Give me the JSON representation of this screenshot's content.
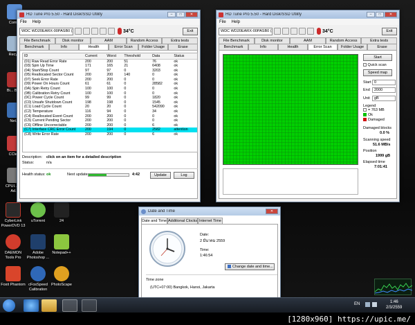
{
  "desktop_icons": [
    {
      "label": "Com..."
    },
    {
      "label": "Recy..."
    },
    {
      "label": "Bi... Be..."
    },
    {
      "label": "Net..."
    },
    {
      "label": "CCle..."
    },
    {
      "label": "CPUI... EF Ad..."
    },
    {
      "label": "CyberLink PowerDVD 13"
    },
    {
      "label": "uTorrent"
    },
    {
      "label": "24"
    },
    {
      "label": "DAEMON Tools Pro"
    },
    {
      "label": "Adobe Photoshop ..."
    },
    {
      "label": "Notepad++"
    },
    {
      "label": "Foxit Phantom"
    },
    {
      "label": "cFosSpeed Calibration"
    },
    {
      "label": "PhotoScape"
    }
  ],
  "left_window": {
    "title": "HD Tune Pro 5.50 - Hard Disk/SSD Utility",
    "menu": [
      "File",
      "Help"
    ],
    "drive": "WDC WD20EARX-00PASB0 (2000 gB)",
    "temperature": "34°C",
    "exit_label": "Exit",
    "tabs_top": [
      "File Benchmark",
      "Disk monitor",
      "AAM",
      "Random Access",
      "Extra tests"
    ],
    "tabs_bottom": [
      "Benchmark",
      "Info",
      "Health",
      "Error Scan",
      "Folder Usage",
      "Erase"
    ],
    "columns": [
      "ID",
      "Current",
      "Worst",
      "Threshold",
      "Data",
      "Status"
    ],
    "rows": [
      [
        "(01) Raw Read Error Rate",
        "200",
        "200",
        "51",
        "76",
        "ok"
      ],
      [
        "(03) Spin Up Time",
        "171",
        "165",
        "21",
        "6408",
        "ok"
      ],
      [
        "(04) Start/Stop Count",
        "97",
        "97",
        "0",
        "3203",
        "ok"
      ],
      [
        "(05) Reallocated Sector Count",
        "200",
        "200",
        "140",
        "0",
        "ok"
      ],
      [
        "(07) Seek Error Rate",
        "200",
        "200",
        "0",
        "0",
        "ok"
      ],
      [
        "(09) Power On Hours Count",
        "61",
        "61",
        "0",
        "28582",
        "ok"
      ],
      [
        "(0A) Spin Retry Count",
        "100",
        "100",
        "0",
        "0",
        "ok"
      ],
      [
        "(0B) Calibration Retry Count",
        "100",
        "100",
        "0",
        "0",
        "ok"
      ],
      [
        "(0C) Power Cycle Count",
        "99",
        "99",
        "0",
        "1820",
        "ok"
      ],
      [
        "(C0) Unsafe Shutdown Count",
        "198",
        "198",
        "0",
        "1545",
        "ok"
      ],
      [
        "(C1) Load Cycle Count",
        "20",
        "20",
        "0",
        "542090",
        "ok"
      ],
      [
        "(C2) Temperature",
        "116",
        "94",
        "0",
        "34",
        "ok"
      ],
      [
        "(C4) Reallocated Event Count",
        "200",
        "200",
        "0",
        "0",
        "ok"
      ],
      [
        "(C5) Current Pending Sector",
        "200",
        "200",
        "0",
        "0",
        "ok"
      ],
      [
        "(C6) Offline Uncorrectable",
        "200",
        "200",
        "0",
        "6",
        "ok"
      ],
      [
        "(C7) Interface CRC Error Count",
        "200",
        "194",
        "0",
        "2582",
        "attention"
      ],
      [
        "(C8) Write Error Rate",
        "200",
        "200",
        "0",
        "6",
        "ok"
      ]
    ],
    "description_label": "Description:",
    "description_value": "click on an item for a detailed description",
    "status_label": "Status:",
    "status_value": "n/a",
    "health_label": "Health status:",
    "health_value": "ok",
    "next_update_label": "Next update:",
    "next_update_time": "4:42",
    "next_update_progress": 0.45,
    "update_label": "Update",
    "log_label": "Log"
  },
  "right_window": {
    "title": "HD Tune Pro 5.50 - Hard Disk/SSD Utility",
    "menu": [
      "File",
      "Help"
    ],
    "drive": "WDC WD20EARX-00PASB0 (2000 gB)",
    "temperature": "34°C",
    "exit_label": "Exit",
    "tabs_top": [
      "File Benchmark",
      "Disk monitor",
      "AAM",
      "Random Access",
      "Extra tests"
    ],
    "tabs_bottom": [
      "Benchmark",
      "Info",
      "Health",
      "Error Scan",
      "Folder Usage",
      "Erase"
    ],
    "start_label": "Start",
    "quick_scan_label": "Quick scan",
    "speed_map_label": "Speed map",
    "start_field_label": "Start",
    "start_value": "0",
    "end_field_label": "End",
    "end_value": "2000",
    "unit_label": "Unit",
    "unit_value": "gB",
    "legend_label": "Legend",
    "legend_items": [
      "= 763 MB",
      "Ok",
      "Damaged"
    ],
    "legend_colors": [
      "#ffffff",
      "#00c000",
      "#d01010"
    ],
    "damaged_blocks_label": "Damaged blocks",
    "damaged_blocks_value": "0.0 %",
    "scanning_speed_label": "Scanning speed",
    "scanning_speed_value": "51.6 MB/s",
    "position_label": "Position",
    "position_value": "1999 gB",
    "elapsed_label": "Elapsed time",
    "elapsed_value": "7:01:41"
  },
  "datetime_dialog": {
    "title": "Date and Time",
    "tabs": [
      "Date and Time",
      "Additional Clocks",
      "Internet Time"
    ],
    "date_label": "Date:",
    "date_value": "2 มีนาคม 2559",
    "time_label": "Time:",
    "time_value": "1:46:54",
    "change_label": "Change date and time...",
    "timezone_label": "Time zone",
    "timezone_value": "(UTC+07:00) Bangkok, Hanoi, Jakarta"
  },
  "taskbar": {
    "language": "EN",
    "clock_time": "1:46",
    "clock_date": "2/3/2559"
  },
  "watermark": "[1280x960] https://upic.me/"
}
